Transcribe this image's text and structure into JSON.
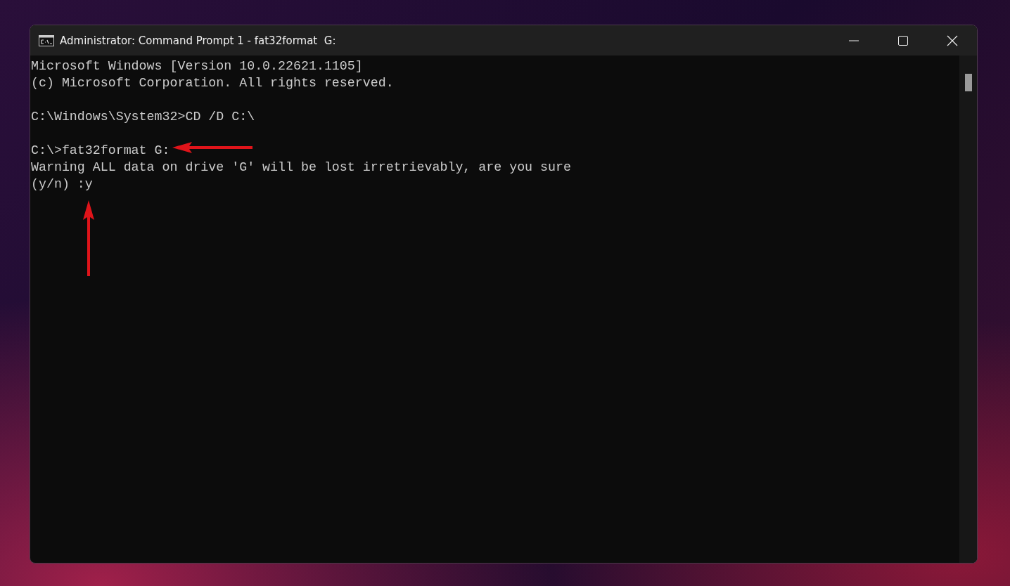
{
  "window": {
    "title": "Administrator: Command Prompt 1 - fat32format  G:"
  },
  "console": {
    "blocks": [
      [
        "Microsoft Windows [Version 10.0.22621.1105]",
        "(c) Microsoft Corporation. All rights reserved."
      ],
      [
        "C:\\Windows\\System32>CD /D C:\\"
      ],
      [
        "C:\\>fat32format G:",
        "Warning ALL data on drive 'G' will be lost irretrievably, are you sure",
        "(y/n) :y"
      ]
    ]
  }
}
